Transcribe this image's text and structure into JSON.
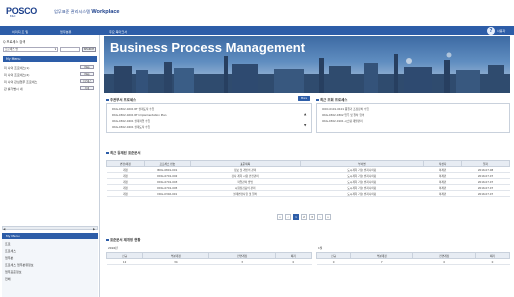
{
  "header": {
    "logo": "POSCO",
    "logo_sub": "E&C",
    "app_prefix": "업무표준 관리시스템",
    "app_title": "Workplace"
  },
  "navbar": {
    "items": [
      "이미지 조 밑",
      "업무분류",
      "주요 북마크서"
    ],
    "help": "사용자"
  },
  "sidebar": {
    "search_label": "Q 프로세스 검색",
    "select_value": "프로세스 명",
    "search_button": "SEARCH",
    "my_menu": "My Menu",
    "items": [
      {
        "label": "미 나의 프로세스(1)",
        "tag": "Map"
      },
      {
        "label": "미 나의 프로세스(2)",
        "tag": "Map"
      },
      {
        "label": "미 나의 관심업무 프로세스",
        "tag": "프로세스"
      },
      {
        "label": "관 를가볍시 내",
        "tag": "삭제"
      }
    ],
    "panel_title": "My Menu",
    "panel_items": [
      "프로",
      "프로세스",
      "업무분",
      "프로세스 업무분류정보",
      "업무표준정보",
      "전체"
    ]
  },
  "banner": {
    "title": "Business Process Management"
  },
  "left_panel": {
    "title": "주관부서 프로세스",
    "more": "More",
    "items": [
      "DKG-0302-0201 RT 설계도작 수립",
      "DKG-0302-0201 RT Implementation Plan",
      "OKG-0302-0201 설계작업 수립",
      "OKG-0302-0201 설계도작 수립"
    ]
  },
  "right_panel": {
    "title": "최근 조회 프로세스",
    "items": [
      "OOO-0101-0101 품질기 조정장치 수립",
      "OKG-0302-0302 업무 및 절차 협의",
      "OKG-0302-0101 시스템 개발관리"
    ]
  },
  "recent_table": {
    "title": "최근 등재된 표준문서",
    "columns": [
      "변경/제정",
      "프로세스 번호",
      "표준제목",
      "부서명",
      "작성자",
      "일자"
    ],
    "rows": [
      [
        "개정",
        "BDG-0801-001",
        "정보 및 개인의 관리",
        "도시계획 기술 엔지니어링",
        "이제민",
        "2016.07.08"
      ],
      [
        "개정",
        "DDG-0701-002",
        "검사 계획 시험 안전관리",
        "도시계획 기술 엔지니어링",
        "이제민",
        "2016.07.07"
      ],
      [
        "개정",
        "DDG-0701-003",
        "작업관리 방법",
        "도시계획 기술 엔지니어링",
        "이제민",
        "2016.07.07"
      ],
      [
        "개정",
        "DDG-0701-005",
        "시험점검표의 관리",
        "도시계획 기술 엔지니어링",
        "이제민",
        "2016.07.07"
      ],
      [
        "개정",
        "DKG-0302-001",
        "설계변경사항 및 절차",
        "도시계획 기술 엔지니어링",
        "이제민",
        "2016.07.07"
      ]
    ]
  },
  "pagination": {
    "pages": [
      "«",
      "‹",
      "1",
      "2",
      "3",
      "›",
      "»"
    ],
    "active": "1"
  },
  "status_tables": {
    "title": "표준문서 제개정 현황",
    "left": {
      "label": "2016년",
      "columns": [
        "신규",
        "부분개정",
        "전면개정",
        "폐기"
      ],
      "values": [
        "12",
        "34",
        "3",
        "0"
      ]
    },
    "right": {
      "label": "1월",
      "columns": [
        "신규",
        "부분개정",
        "전면개정",
        "폐기"
      ],
      "values": [
        "0",
        "7",
        "0",
        "0"
      ]
    }
  }
}
